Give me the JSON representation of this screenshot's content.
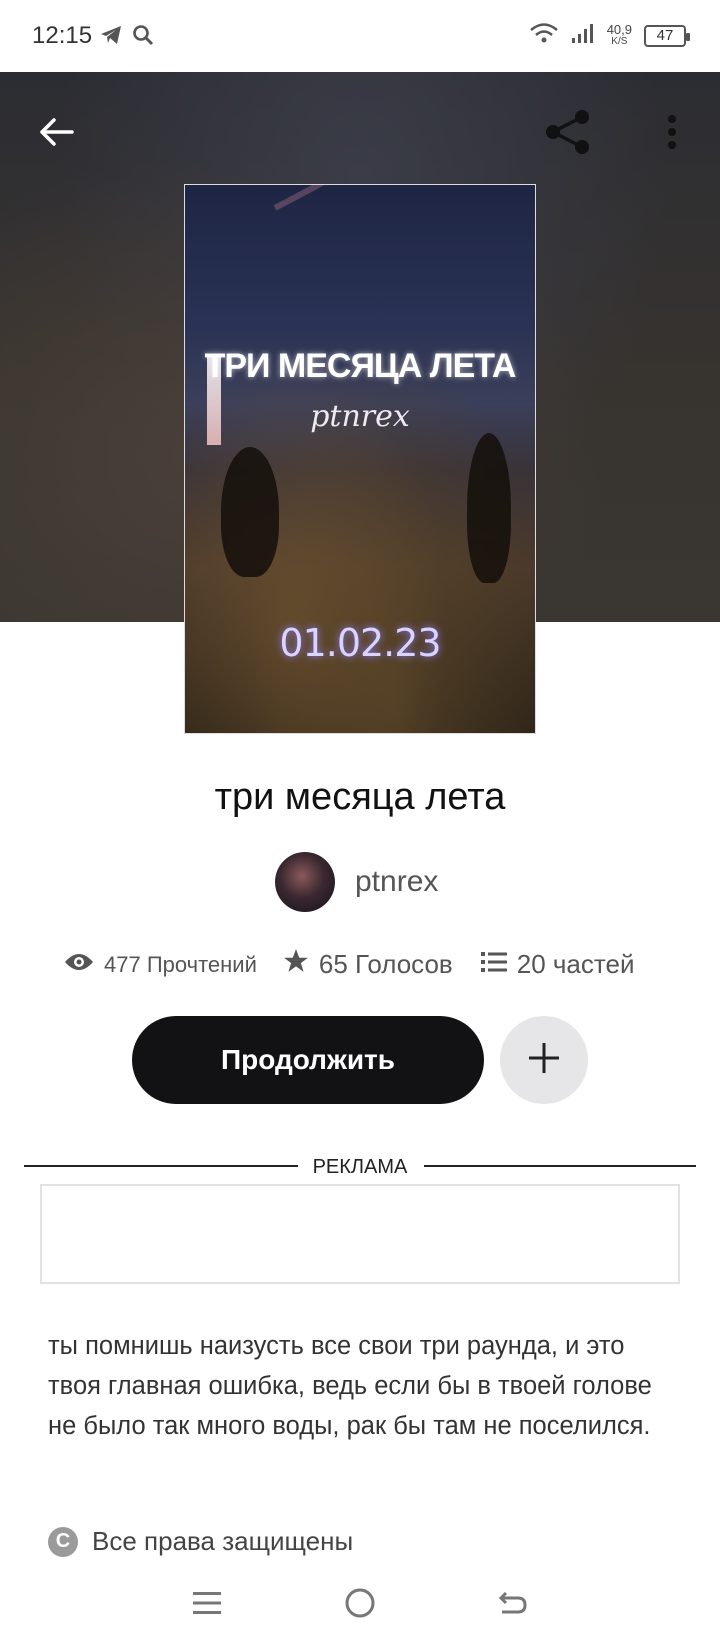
{
  "status_bar": {
    "time": "12:15",
    "net_speed_value": "40,9",
    "net_speed_unit": "K/S",
    "battery": "47"
  },
  "book": {
    "cover": {
      "title": "ТРИ МЕСЯЦА ЛЕТА",
      "author": "ptnrex",
      "date": "01.02.23"
    },
    "title": "три месяца лета",
    "author": "ptnrex",
    "stats": {
      "reads": "477 Прочтений",
      "votes": "65 Голосов",
      "parts": "20 частей"
    },
    "continue_label": "Продолжить",
    "ad_label": "РЕКЛАМА",
    "description": "ты помнишь наизусть все свои три раунда, и это твоя главная ошибка, ведь если бы в твоей голове не было так много воды, рак бы там не поселился.",
    "copyright": "Все права защищены"
  },
  "icons": {
    "back": "arrow-left-icon",
    "share": "share-icon",
    "more": "more-vertical-icon",
    "views": "eye-icon",
    "votes": "star-icon",
    "parts": "list-icon",
    "add": "plus-icon",
    "copyright": "copyright-icon"
  },
  "colors": {
    "button_dark": "#121214",
    "button_light": "#e6e5e8",
    "text_secondary": "#555555"
  }
}
